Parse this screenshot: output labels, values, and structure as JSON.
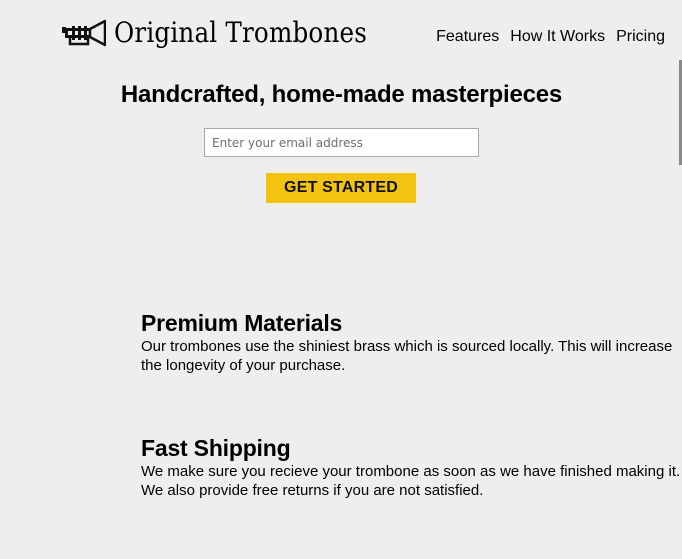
{
  "brand": {
    "name": "Original Trombones",
    "icon": "trombone-icon"
  },
  "nav": {
    "items": [
      {
        "label": "Features"
      },
      {
        "label": "How It Works"
      },
      {
        "label": "Pricing"
      }
    ]
  },
  "hero": {
    "title": "Handcrafted, home-made masterpieces",
    "email_placeholder": "Enter your email address",
    "email_value": "",
    "cta_label": "GET STARTED"
  },
  "features": [
    {
      "title": "Premium Materials",
      "description": "Our trombones use the shiniest brass which is sourced locally. This will increase the longevity of your purchase."
    },
    {
      "title": "Fast Shipping",
      "description": "We make sure you recieve your trombone as soon as we have finished making it. We also provide free returns if you are not satisfied."
    }
  ],
  "colors": {
    "background": "#eeeeee",
    "cta_background": "#f2c40f",
    "text": "#000000"
  }
}
